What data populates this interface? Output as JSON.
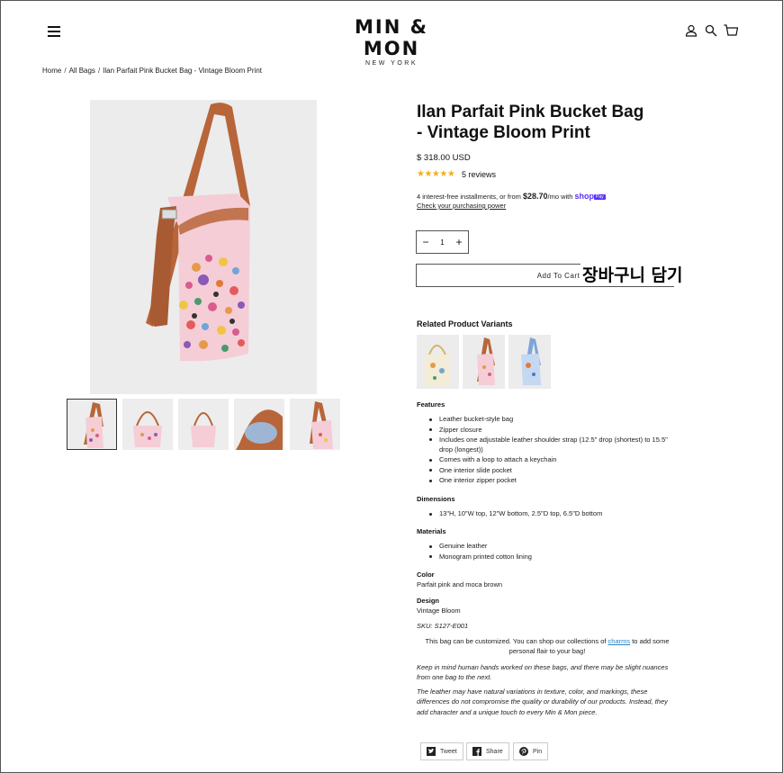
{
  "brand": {
    "logo_main": "MIN & MON",
    "logo_sub": "NEW YORK"
  },
  "header": {
    "menu_icon": "hamburger-menu-icon",
    "account_icon": "user-icon",
    "search_icon": "search-icon",
    "cart_icon": "cart-icon"
  },
  "breadcrumb": {
    "home": "Home",
    "all_bags": "All Bags",
    "current": "Ilan Parfait Pink Bucket Bag - Vintage Bloom Print"
  },
  "product": {
    "title": "Ilan Parfait Pink Bucket Bag - Vintage Bloom Print",
    "price": "$ 318.00 USD",
    "rating": 5,
    "reviews": "5 reviews",
    "installments_prefix": "4 interest-free installments, or from ",
    "installments_amount": "$28.70",
    "installments_suffix": "/mo with ",
    "shop_logo": "shop",
    "shop_badge": "Pay",
    "check_link": "Check your purchasing power",
    "quantity": "1",
    "qty_minus": "−",
    "qty_plus": "+",
    "add_to_cart": "Add To Cart",
    "annotation_korean": "장바구니 담기",
    "related_title": "Related Product Variants"
  },
  "colors": {
    "accent_shop": "#5a31f4",
    "star": "#f2b01e",
    "link": "#2a83c4",
    "bag_pink": "#f5cdd6",
    "strap_brown": "#b8653a"
  },
  "details": {
    "features_heading": "Features",
    "features": [
      "Leather bucket-style bag",
      "Zipper closure",
      "Includes one adjustable leather shoulder strap (12.5\" drop (shortest) to 15.5\" drop (longest))",
      "Comes with a loop to attach a keychain",
      "One interior slide pocket",
      "One interior zipper pocket"
    ],
    "dimensions_heading": "Dimensions",
    "dimensions": [
      "13\"H,  10\"W top, 12\"W bottom, 2.5\"D top, 6.5\"D bottom"
    ],
    "materials_heading": "Materials",
    "materials": [
      "Genuine leather",
      "Monogram printed cotton lining"
    ],
    "color_heading": "Color",
    "color_value": "Parfait pink and moca brown",
    "design_heading": "Design",
    "design_value": "Vintage Bloom",
    "sku": "SKU: S127-E001",
    "custom_prefix": "This bag can be customized. You can shop our collections of ",
    "custom_link": "charms",
    "custom_suffix": " to add some personal flair to your bag!",
    "note1": "Keep in mind human hands worked on these bags, and there may be slight nuances from one bag to the next.",
    "note2": "The leather may have natural variations in texture, color, and markings, these differences do not compromise the quality or durability of our products. Instead, they add character and a unique touch to every Min & Mon piece."
  },
  "share": {
    "tweet": "Tweet",
    "share": "Share",
    "pin": "Pin"
  }
}
